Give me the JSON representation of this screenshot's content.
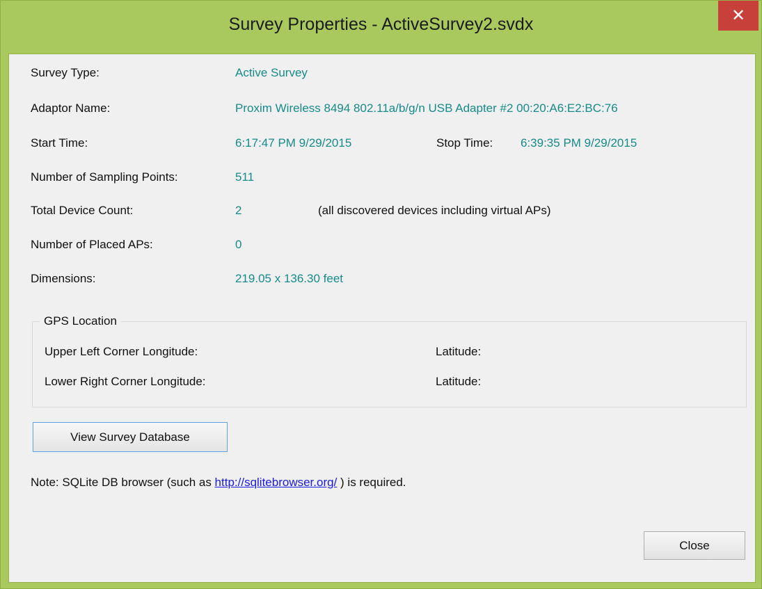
{
  "window": {
    "title": "Survey Properties - ActiveSurvey2.svdx",
    "close_glyph": "✕",
    "accent_color": "#a9c95e",
    "close_color": "#c7413a",
    "value_color": "#178a8a"
  },
  "fields": {
    "survey_type_label": "Survey Type:",
    "survey_type_value": "Active Survey",
    "adaptor_name_label": "Adaptor Name:",
    "adaptor_name_value": "Proxim Wireless 8494 802.11a/b/g/n USB Adapter #2 00:20:A6:E2:BC:76",
    "start_time_label": "Start Time:",
    "start_time_value": "6:17:47 PM 9/29/2015",
    "stop_time_label": "Stop Time:",
    "stop_time_value": "6:39:35 PM 9/29/2015",
    "sampling_points_label": "Number of Sampling Points:",
    "sampling_points_value": "511",
    "device_count_label": "Total Device Count:",
    "device_count_value": "2",
    "device_count_note": "(all discovered devices including virtual APs)",
    "placed_aps_label": "Number of Placed APs:",
    "placed_aps_value": "0",
    "dimensions_label": "Dimensions:",
    "dimensions_value": "219.05 x 136.30 feet"
  },
  "gps": {
    "legend": "GPS Location",
    "upper_left_longitude_label": "Upper Left Corner Longitude:",
    "upper_left_latitude_label": "Latitude:",
    "lower_right_longitude_label": "Lower Right Corner Longitude:",
    "lower_right_latitude_label": "Latitude:"
  },
  "buttons": {
    "view_db_label": "View Survey Database",
    "close_label": "Close"
  },
  "note": {
    "prefix": "Note: SQLite DB browser (such as ",
    "link_text": "http://sqlitebrowser.org/",
    "suffix": " ) is required."
  }
}
